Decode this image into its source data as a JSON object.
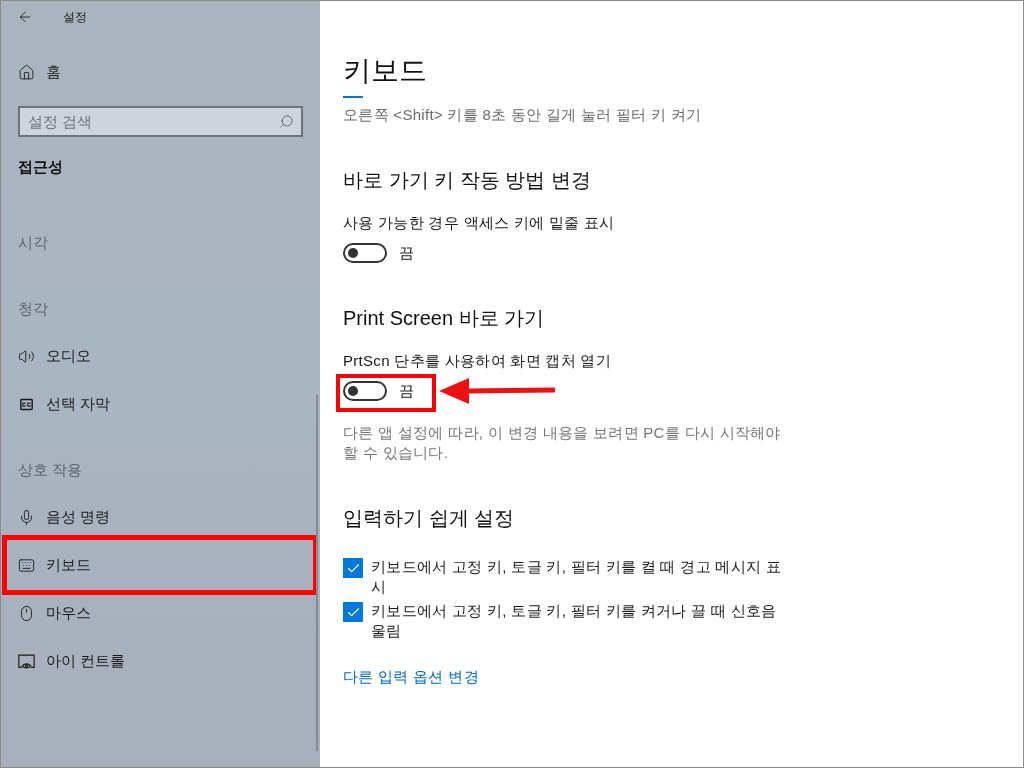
{
  "window": {
    "title": "설정"
  },
  "sidebar": {
    "home": "홈",
    "search": {
      "placeholder": "설정 검색"
    },
    "category": "접근성",
    "groups": [
      {
        "header": "시각"
      },
      {
        "header": "청각",
        "items": [
          {
            "label": "오디오",
            "kind": "speaker"
          },
          {
            "label": "선택 자막",
            "kind": "captions"
          }
        ]
      },
      {
        "header": "상호 작용",
        "items": [
          {
            "label": "음성 명령",
            "kind": "microphone"
          },
          {
            "label": "키보드",
            "kind": "keyboard",
            "highlighted": true
          },
          {
            "label": "마우스",
            "kind": "mouse"
          },
          {
            "label": "아이 컨트롤",
            "kind": "eye-control"
          }
        ]
      }
    ]
  },
  "main": {
    "title": "키보드",
    "intro": "오른쪽 <Shift> 키를 8초 동안 길게 눌러 필터 키 켜기",
    "sections": [
      {
        "heading": "바로 가기 키 작동 방법 변경",
        "settings": [
          {
            "kind": "toggle",
            "label": "사용 가능한 경우 액세스 키에 밑줄 표시",
            "on": false,
            "state_text": "끔"
          }
        ]
      },
      {
        "heading": "Print Screen 바로 가기",
        "settings": [
          {
            "kind": "toggle",
            "label": "PrtScn 단추를 사용하여 화면 캡처 열기",
            "on": false,
            "state_text": "끔",
            "highlighted": true
          },
          {
            "kind": "note",
            "text": "다른 앱 설정에 따라, 이 변경 내용을 보려면 PC를 다시 시작해야 할 수 있습니다."
          }
        ]
      },
      {
        "heading": "입력하기 쉽게 설정",
        "settings": [
          {
            "kind": "checkbox",
            "label": "키보드에서 고정 키, 토글 키, 필터 키를 켤 때 경고 메시지 표시",
            "checked": true
          },
          {
            "kind": "checkbox",
            "label": "키보드에서 고정 키, 토글 키, 필터 키를 켜거나 끌 때 신호음 울림",
            "checked": true
          }
        ]
      }
    ],
    "link": "다른 입력 옵션 변경"
  }
}
